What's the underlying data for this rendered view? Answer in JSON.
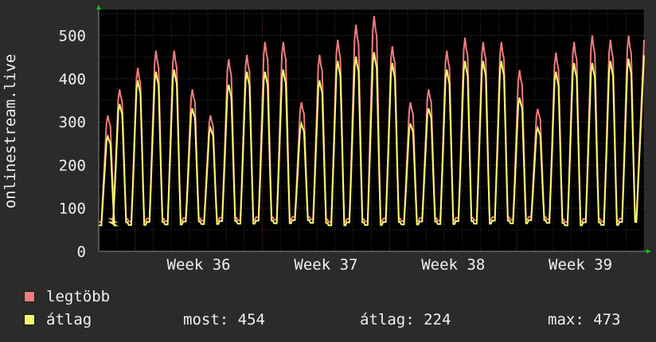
{
  "chart_data": {
    "type": "line",
    "ylabel": "onlinestream.live",
    "ylim": [
      0,
      560
    ],
    "yticks": [
      0,
      100,
      200,
      300,
      400,
      500
    ],
    "x_tick_labels": [
      "Week 36",
      "Week 37",
      "Week 38",
      "Week 39"
    ],
    "days": 30,
    "series": [
      {
        "name": "legtöbb",
        "color": "#f07c7c",
        "daily_peaks": [
          315,
          375,
          425,
          465,
          465,
          375,
          315,
          445,
          455,
          485,
          485,
          345,
          455,
          490,
          525,
          545,
          475,
          345,
          375,
          465,
          495,
          485,
          485,
          420,
          330,
          460,
          485,
          500,
          490,
          500
        ]
      },
      {
        "name": "átlag",
        "color": "#f8f870",
        "daily_peaks": [
          270,
          345,
          400,
          420,
          425,
          335,
          290,
          390,
          420,
          420,
          425,
          300,
          400,
          445,
          455,
          465,
          440,
          300,
          335,
          425,
          445,
          445,
          445,
          360,
          290,
          420,
          440,
          440,
          445,
          450
        ]
      }
    ],
    "daily_min": 60,
    "grid": true
  },
  "legend": {
    "max_label": "legtöbb",
    "avg_label": "átlag",
    "most": "most: 454",
    "atlag": "átlag: 224",
    "max": "max: 473"
  },
  "colors": {
    "background": "#2b2b2b",
    "plot_background": "#000000",
    "grid": "#3a3a3a",
    "text": "#f0f0f0",
    "axis_arrow": "#00cc00"
  }
}
